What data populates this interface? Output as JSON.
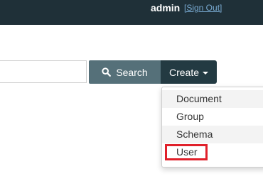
{
  "header": {
    "username": "admin",
    "signout_label": "[Sign Out]"
  },
  "search": {
    "value": "",
    "placeholder": "",
    "button_label": "Search"
  },
  "create": {
    "label": "Create",
    "menu_items": [
      {
        "label": "Document"
      },
      {
        "label": "Group"
      },
      {
        "label": "Schema"
      },
      {
        "label": "User"
      }
    ],
    "highlighted_item": "User"
  },
  "colors": {
    "topbar": "#1f3038",
    "search_button": "#557079",
    "create_button": "#233a42",
    "link": "#78a9d0",
    "highlight_box": "#e0202a"
  },
  "icons": {
    "search": "magnifier-icon",
    "create_caret": "caret-down-icon"
  }
}
